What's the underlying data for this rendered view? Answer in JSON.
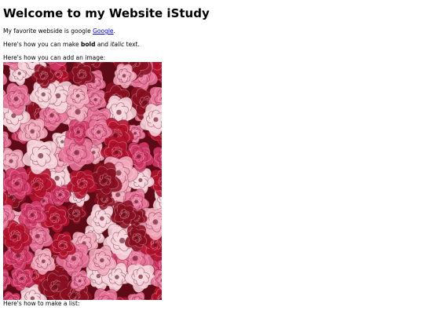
{
  "heading": "Welcome to my Website iStudy",
  "intro": {
    "prefix": "My favorite webside is google ",
    "link_label": "Google",
    "suffix": "."
  },
  "formatting": {
    "prefix": "Here's how you can make ",
    "bold": "bold",
    "middle": " and ",
    "italic": "italic",
    "suffix": " text."
  },
  "image_intro": "Here's how you can add an image:",
  "image": {
    "subject": "pink and red roses",
    "colors": [
      "#8c0f22",
      "#b5122e",
      "#d43a6a",
      "#e8739a",
      "#f2a9bd",
      "#f7d3dc",
      "#5e0a17"
    ]
  },
  "list_intro": "Here's how to make a list:"
}
